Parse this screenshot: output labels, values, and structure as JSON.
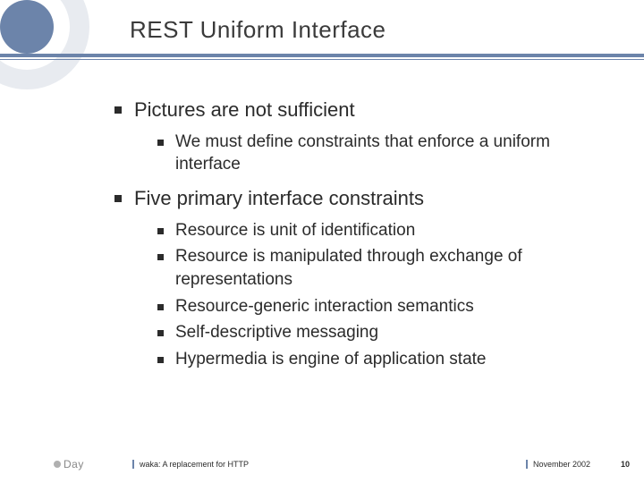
{
  "title": "REST Uniform Interface",
  "bullets": {
    "b0": {
      "text": "Pictures are not sufficient",
      "sub": {
        "s0": "We must define constraints that enforce a uniform interface"
      }
    },
    "b1": {
      "text": "Five primary interface constraints",
      "sub": {
        "s0": "Resource is unit of identification",
        "s1": "Resource is manipulated through exchange of representations",
        "s2": "Resource-generic interaction semantics",
        "s3": "Self-descriptive messaging",
        "s4": "Hypermedia is engine of application state"
      }
    }
  },
  "footer": {
    "logo_text": "Day",
    "left": "waka: A replacement for HTTP",
    "right": "November 2002",
    "page": "10"
  }
}
